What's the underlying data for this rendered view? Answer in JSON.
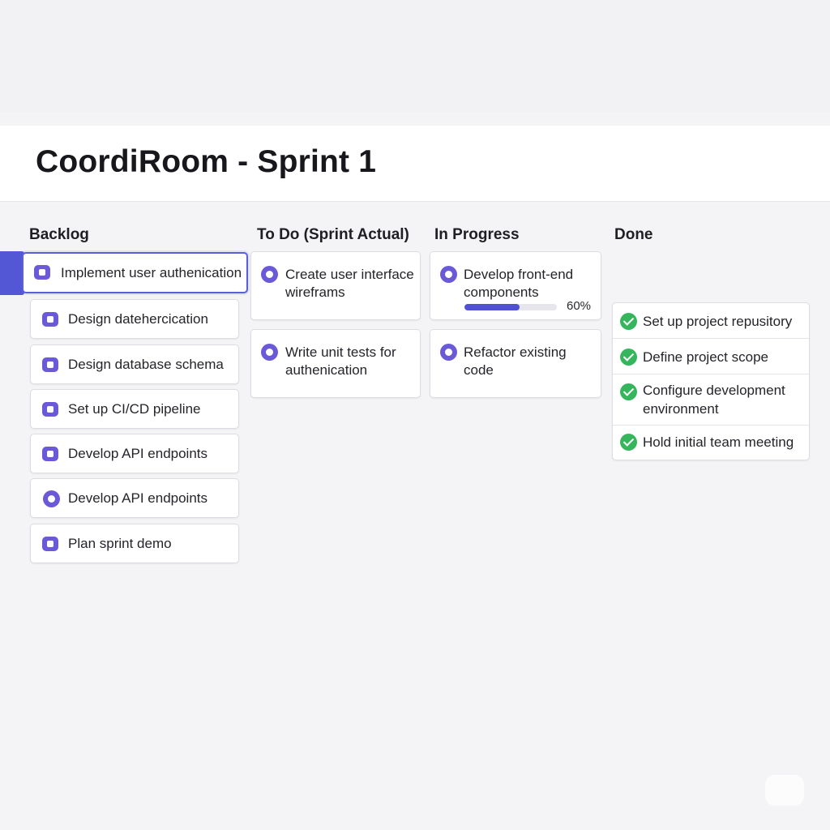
{
  "page": {
    "title": "CoordiRoom - Sprint 1"
  },
  "columns": {
    "backlog": {
      "title": "Backlog",
      "items": [
        {
          "label": "Implement user authenication",
          "icon": "shield-icon",
          "active": true
        },
        {
          "label": "Design datehercication",
          "icon": "users-icon"
        },
        {
          "label": "Design database schema",
          "icon": "database-icon"
        },
        {
          "label": "Set up CI/CD pipeline",
          "icon": "pipeline-icon"
        },
        {
          "label": "Develop API endpoints",
          "icon": "api-icon"
        },
        {
          "label": "Develop API endpoints",
          "icon": "code-icon"
        },
        {
          "label": "Plan sprint demo",
          "icon": "presentation-icon"
        }
      ]
    },
    "todo": {
      "title": "To Do (Sprint Actual)",
      "items": [
        {
          "label": "Create user interface wireframs",
          "icon": "target-icon"
        },
        {
          "label": "Write unit tests for authenication",
          "icon": "target-icon"
        }
      ]
    },
    "in_progress": {
      "title": "In Progress",
      "items": [
        {
          "label": "Develop front-end components",
          "icon": "gear-icon",
          "progress": 0.6,
          "progress_label": "60%"
        },
        {
          "label": "Refactor existing code",
          "icon": "target-icon"
        }
      ]
    },
    "done": {
      "title": "Done",
      "items": [
        {
          "label": "Set up project repusitory",
          "icon": "check-circle-icon"
        },
        {
          "label": "Define project scope",
          "icon": "check-circle-icon"
        },
        {
          "label": "Configure development environment",
          "icon": "check-circle-icon"
        },
        {
          "label": "Hold initial team meeting",
          "icon": "check-circle-icon"
        }
      ]
    }
  },
  "colors": {
    "accent": "#5b5fdc",
    "icon": "#6a5ad8",
    "done": "#36b65c",
    "progress": "#4f4fd8"
  }
}
